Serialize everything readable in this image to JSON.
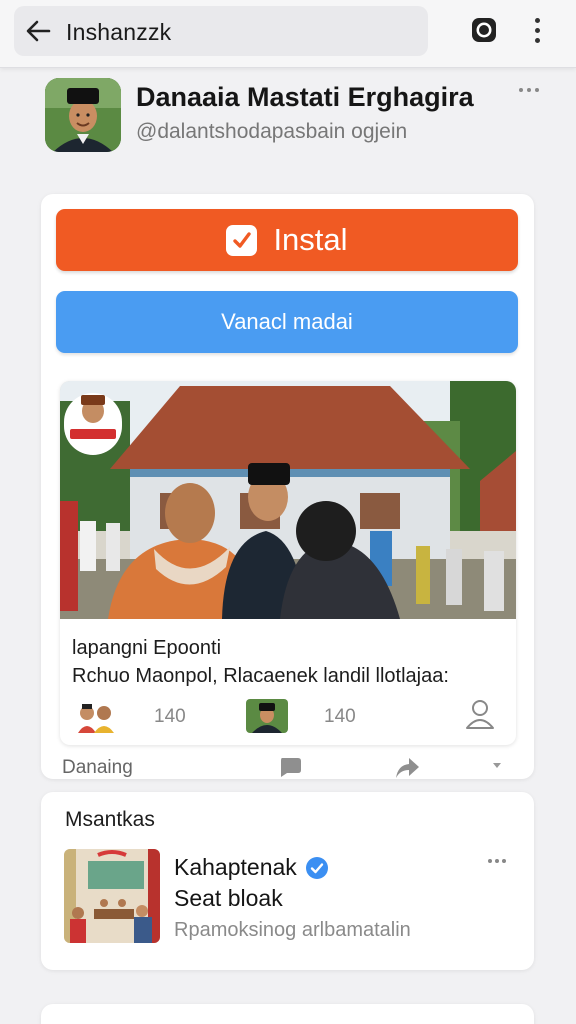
{
  "browser": {
    "url_text": "Inshanzzk",
    "icons": {
      "back": "arrow-left-icon",
      "camera": "camera-icon",
      "menu": "kebab-menu-icon"
    }
  },
  "profile": {
    "name": "Danaaia Mastati Erghagira",
    "handle": "@dalantshodapasbain ogjein",
    "avatar_icon": "avatar-photo"
  },
  "card": {
    "install_label": "Instal",
    "secondary_label": "Vanacl madai",
    "colors": {
      "install": "#f05a23",
      "secondary": "#4a9cf2"
    }
  },
  "post": {
    "caption_title": "lapangni Epoonti",
    "caption_text": "Rchuo Maonpol, Rlacaenek landil llotlajaa:",
    "stats": [
      {
        "count": "140",
        "icon": "group-avatar-icon"
      },
      {
        "count": "140",
        "icon": "person-avatar-icon"
      }
    ],
    "person_icon": "person-outline-icon"
  },
  "actions": {
    "label": "Danaing",
    "icons": [
      "comment-icon",
      "share-icon",
      "chevron-down-icon"
    ]
  },
  "suggestion": {
    "heading": "Msantkas",
    "name": "Kahaptenak",
    "subtitle": "Seat bloak",
    "description": "Rpamoksinog arlbamatalin",
    "verified_color": "#3b8ff2"
  }
}
